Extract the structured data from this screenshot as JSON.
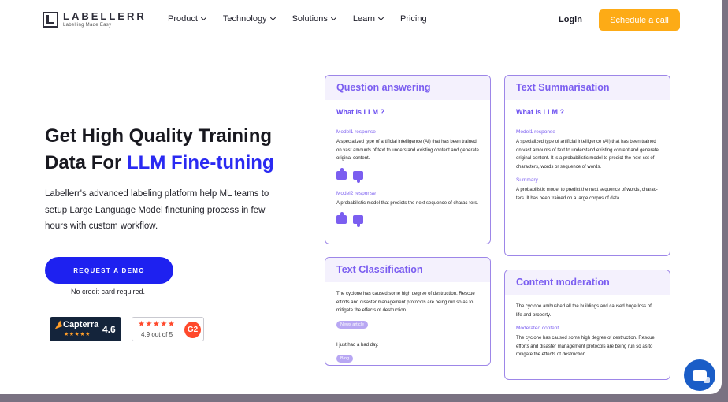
{
  "brand": {
    "name": "LABELLERR",
    "tagline": "Labelling Made Easy"
  },
  "nav": {
    "items": [
      {
        "label": "Product",
        "dropdown": true
      },
      {
        "label": "Technology",
        "dropdown": true
      },
      {
        "label": "Solutions",
        "dropdown": true
      },
      {
        "label": "Learn",
        "dropdown": true
      },
      {
        "label": "Pricing",
        "dropdown": false
      }
    ],
    "login": "Login",
    "cta": "Schedule a call"
  },
  "hero": {
    "title_line1": "Get High Quality Training",
    "title_prefix": "Data For ",
    "title_accent": "LLM Fine-tuning",
    "description": "Labellerr's advanced labeling platform help ML teams to setup Large Language Model finetuning process in few hours with custom workflow.",
    "demo_button": "REQUEST A DEMO",
    "no_card": "No credit card required."
  },
  "ratings": {
    "capterra": {
      "name": "Capterra",
      "stars": "★★★★★",
      "score": "4.6"
    },
    "g2": {
      "stars": "★★★★★",
      "score": "4.9 out of 5",
      "badge": "G2"
    }
  },
  "cards": {
    "qa": {
      "title": "Question answering",
      "question": "What is LLM ?",
      "model1_label": "Model1 response",
      "model1_text": "A specialized type of artificial intelligence (AI) that has been trained on vast amounts of text to understand existing content and generate original content.",
      "model2_label": "Model2 response",
      "model2_text": "A probabilistic model that predicts the next sequence of charac-ters."
    },
    "summarisation": {
      "title": "Text Summarisation",
      "question": "What is LLM ?",
      "model1_label": "Model1 response",
      "model1_text": "A specialized type of artificial intelligence (AI) that has been trained on vast amounts of text to understand existing content and generate original content. It is a probabilistic model to predict the next set of characters, words or sequence of words.",
      "summary_label": "Summary",
      "summary_text": "A probabilistic model to predict the next sequence of words, charac-ters. It has been trained on a large corpus of data."
    },
    "classification": {
      "title": "Text Classification",
      "text1": "The cyclone has caused some high degree of destruction. Rescue efforts and disaster management protocols are being run so as to mitigate the effects of destruction.",
      "tag1": "News article",
      "text2": "I just had a bad day.",
      "tag2": "Blog"
    },
    "moderation": {
      "title": "Content moderation",
      "text1": "The cyclone ambushed all the buildings and caused huge loss of life and property.",
      "moderated_label": "Moderated content",
      "moderated_text": "The cyclone has caused some high degree of destruction. Rescue efforts and disaster management protocols are being run so as to mitigate the effects of destruction."
    }
  },
  "colors": {
    "accent": "#7b5ef0",
    "cta": "#fdab16",
    "primary": "#1e21f0",
    "chat": "#1a5dc7"
  }
}
